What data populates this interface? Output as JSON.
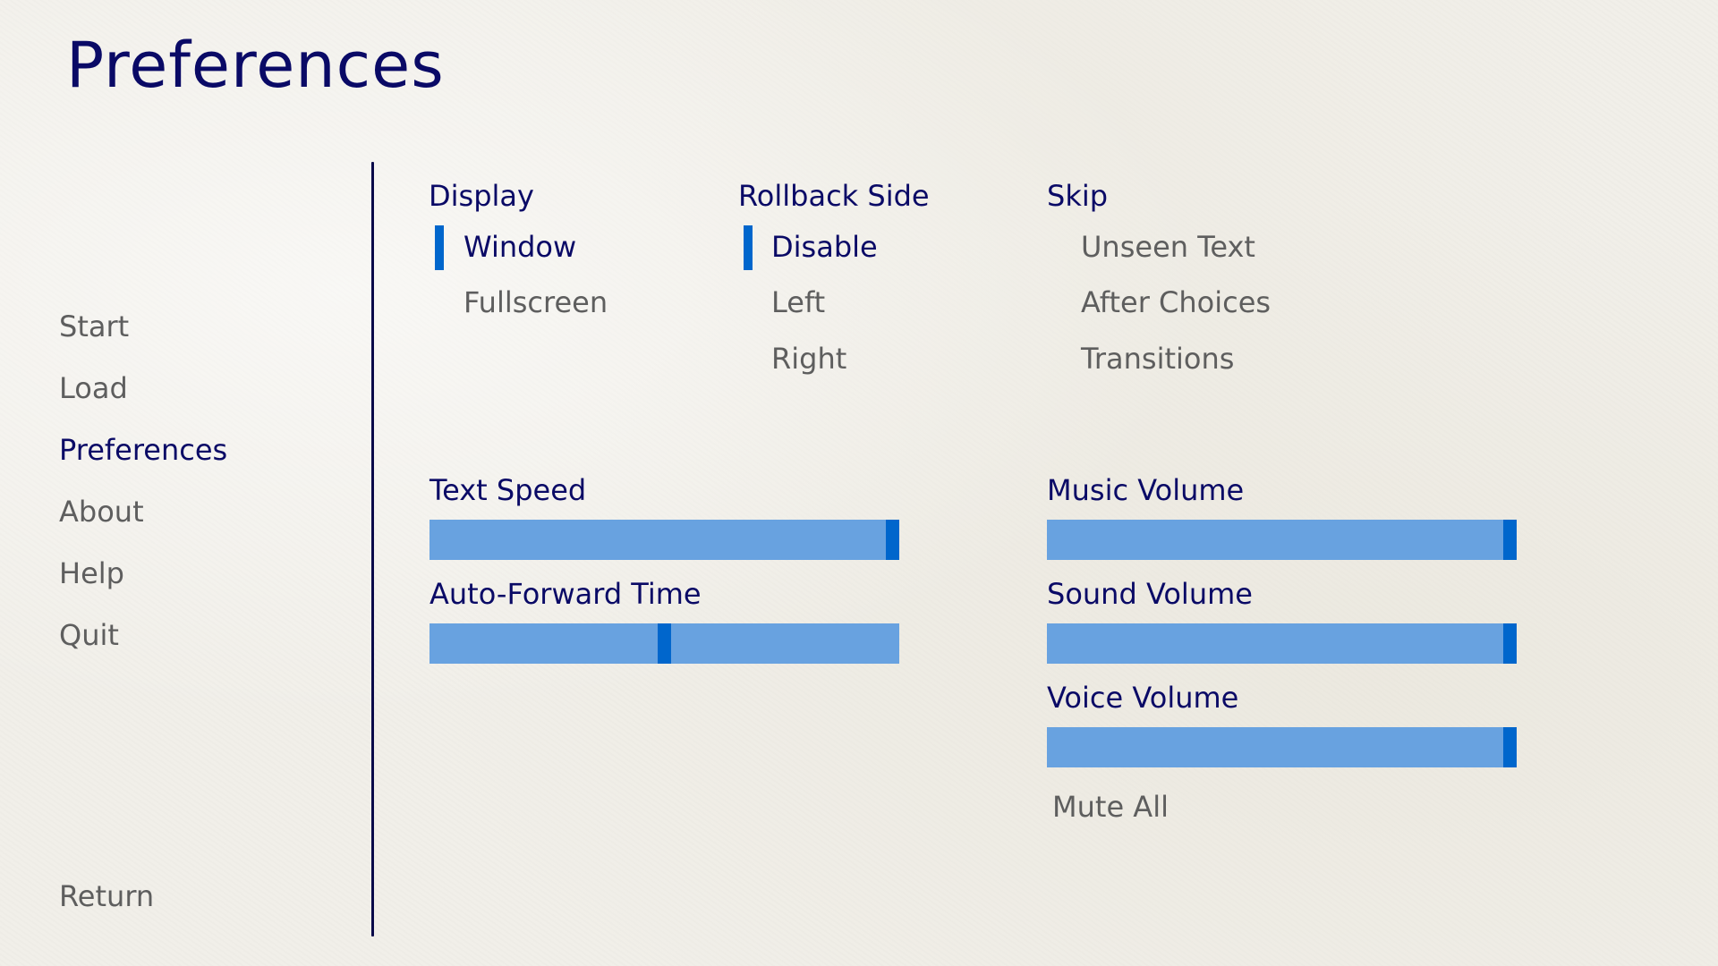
{
  "title": "Preferences",
  "nav": {
    "items": [
      {
        "label": "Start",
        "active": false
      },
      {
        "label": "Load",
        "active": false
      },
      {
        "label": "Preferences",
        "active": true
      },
      {
        "label": "About",
        "active": false
      },
      {
        "label": "Help",
        "active": false
      },
      {
        "label": "Quit",
        "active": false
      }
    ],
    "return_label": "Return"
  },
  "display": {
    "heading": "Display",
    "options": [
      {
        "label": "Window",
        "selected": true
      },
      {
        "label": "Fullscreen",
        "selected": false
      }
    ]
  },
  "rollback": {
    "heading": "Rollback Side",
    "options": [
      {
        "label": "Disable",
        "selected": true
      },
      {
        "label": "Left",
        "selected": false
      },
      {
        "label": "Right",
        "selected": false
      }
    ]
  },
  "skip": {
    "heading": "Skip",
    "options": [
      {
        "label": "Unseen Text",
        "selected": false
      },
      {
        "label": "After Choices",
        "selected": false
      },
      {
        "label": "Transitions",
        "selected": false
      }
    ]
  },
  "sliders": {
    "text_speed": {
      "label": "Text Speed",
      "value": 1.0
    },
    "auto_forward": {
      "label": "Auto-Forward Time",
      "value": 0.5
    },
    "music_volume": {
      "label": "Music Volume",
      "value": 1.0
    },
    "sound_volume": {
      "label": "Sound Volume",
      "value": 1.0
    },
    "voice_volume": {
      "label": "Voice Volume",
      "value": 1.0
    }
  },
  "mute_all": {
    "label": "Mute All",
    "selected": false
  },
  "colors": {
    "accent": "#0066cc",
    "bar": "#68a2e0",
    "text_active": "#0a0a66",
    "text_idle": "#5e5e5e",
    "background": "#f1efe9"
  }
}
